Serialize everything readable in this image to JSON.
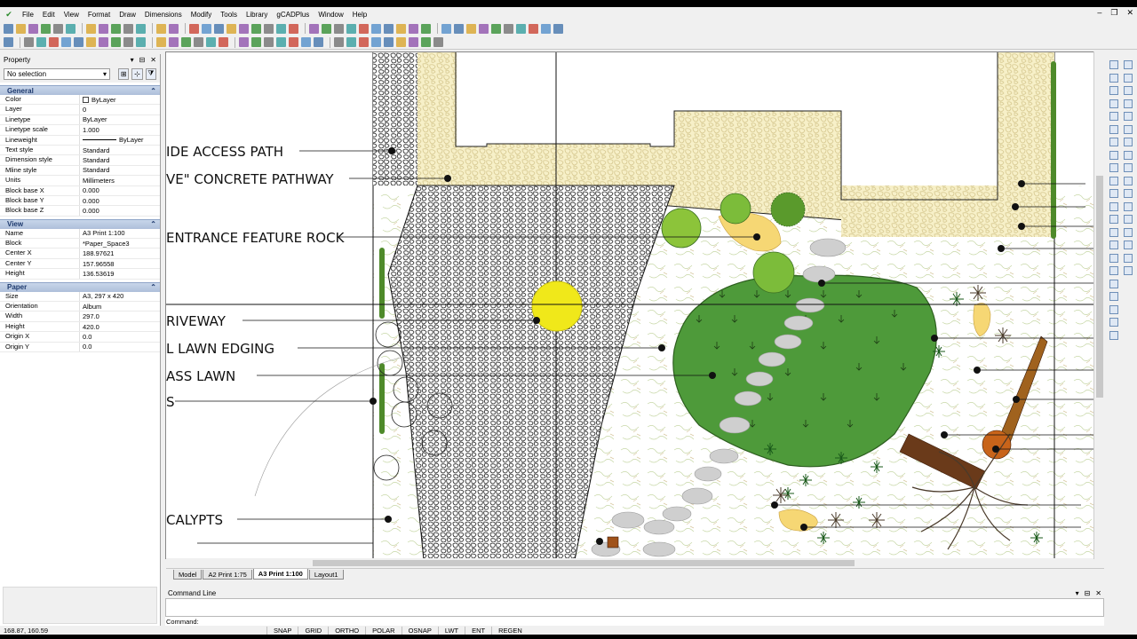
{
  "menu": [
    "File",
    "Edit",
    "View",
    "Format",
    "Draw",
    "Dimensions",
    "Modify",
    "Tools",
    "Library",
    "gCADPlus",
    "Window",
    "Help"
  ],
  "property_panel": {
    "title": "Property",
    "selection": "No selection",
    "sections": [
      {
        "title": "General",
        "rows": [
          {
            "k": "Color",
            "v": "ByLayer"
          },
          {
            "k": "Layer",
            "v": "0"
          },
          {
            "k": "Linetype",
            "v": "ByLayer"
          },
          {
            "k": "Linetype scale",
            "v": "1.000"
          },
          {
            "k": "Lineweight",
            "v": "ByLayer"
          },
          {
            "k": "Text style",
            "v": "Standard"
          },
          {
            "k": "Dimension style",
            "v": "Standard"
          },
          {
            "k": "Mline style",
            "v": "Standard"
          },
          {
            "k": "Units",
            "v": "Millimeters"
          },
          {
            "k": "Block base X",
            "v": "0.000"
          },
          {
            "k": "Block base Y",
            "v": "0.000"
          },
          {
            "k": "Block base Z",
            "v": "0.000"
          }
        ]
      },
      {
        "title": "View",
        "rows": [
          {
            "k": "Name",
            "v": "A3 Print 1:100"
          },
          {
            "k": "Block",
            "v": "*Paper_Space3"
          },
          {
            "k": "Center X",
            "v": "188.97621"
          },
          {
            "k": "Center Y",
            "v": "157.96558"
          },
          {
            "k": "Height",
            "v": "136.53619"
          }
        ]
      },
      {
        "title": "Paper",
        "rows": [
          {
            "k": "Size",
            "v": "A3,  297 x 420"
          },
          {
            "k": "Orientation",
            "v": "Album"
          },
          {
            "k": "Width",
            "v": "297.0"
          },
          {
            "k": "Height",
            "v": "420.0"
          },
          {
            "k": "Origin X",
            "v": "0.0"
          },
          {
            "k": "Origin Y",
            "v": "0.0"
          }
        ]
      }
    ]
  },
  "drawing_labels": {
    "side_access": "IDE ACCESS PATH",
    "concrete": "VE\" CONCRETE PATHWAY",
    "entrance": "ENTRANCE FEATURE ROCK",
    "driveway": "RIVEWAY",
    "edging": "L LAWN EDGING",
    "lawn": "ASS LAWN",
    "s": "S",
    "calypts": "CALYPTS"
  },
  "tabs": [
    {
      "label": "Model",
      "active": false
    },
    {
      "label": "A2 Print 1:75",
      "active": false
    },
    {
      "label": "A3 Print 1:100",
      "active": true
    },
    {
      "label": "Layout1",
      "active": false
    }
  ],
  "command": {
    "title": "Command Line",
    "prompt": "Command:"
  },
  "status": {
    "coords": "168.87,  160.59",
    "buttons": [
      "SNAP",
      "GRID",
      "ORTHO",
      "POLAR",
      "OSNAP",
      "LWT",
      "ENT",
      "REGEN"
    ]
  },
  "colors": {
    "lawn": "#4e9a3a",
    "path": "#f3ecc4",
    "accent": "#f0e81a",
    "wood": "#6a3a1a"
  }
}
